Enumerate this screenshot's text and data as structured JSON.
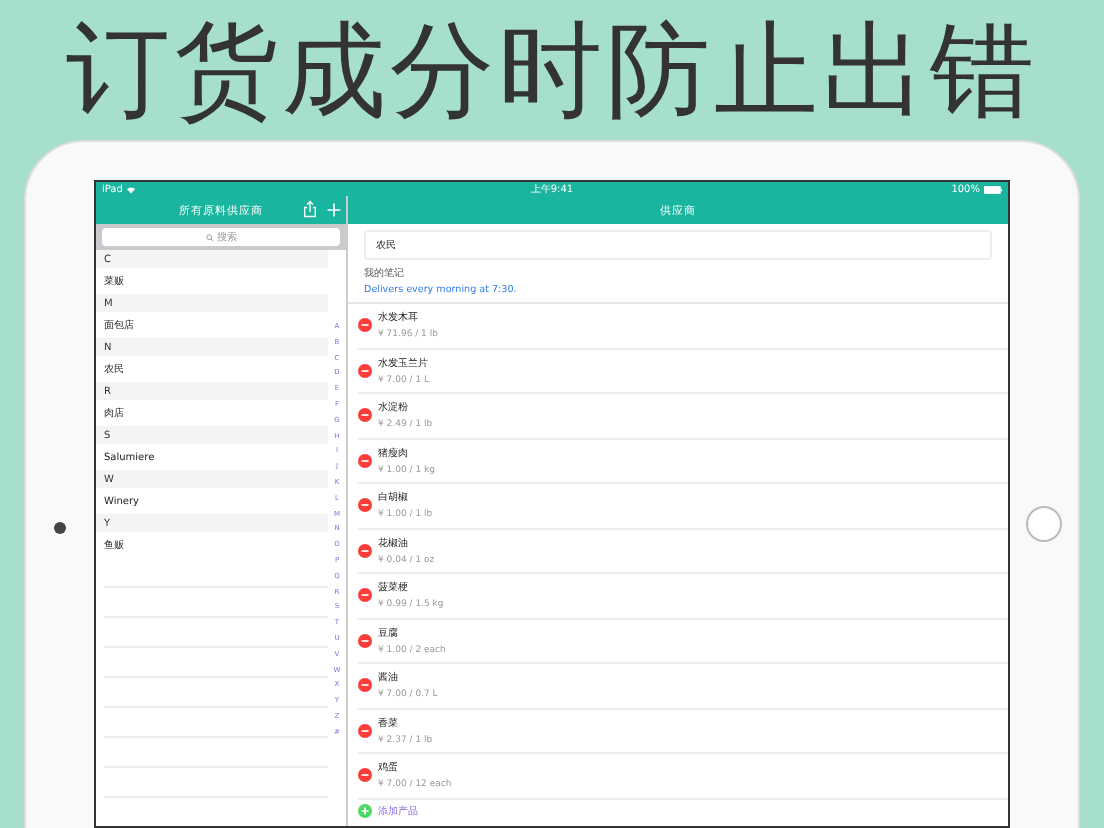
{
  "headline": "订货成分时防止出错",
  "status_bar": {
    "device": "iPad",
    "time": "上午9:41",
    "battery": "100%"
  },
  "sidebar": {
    "title": "所有原料供应商",
    "search": {
      "placeholder": "搜索"
    },
    "sections": [
      {
        "header": "C",
        "items": [
          "菜贩"
        ]
      },
      {
        "header": "M",
        "items": [
          "面包店"
        ]
      },
      {
        "header": "N",
        "items": [
          "农民"
        ]
      },
      {
        "header": "R",
        "items": [
          "肉店"
        ]
      },
      {
        "header": "S",
        "items": [
          "Salumiere"
        ]
      },
      {
        "header": "W",
        "items": [
          "Winery"
        ]
      },
      {
        "header": "Y",
        "items": [
          "鱼贩"
        ]
      }
    ],
    "index": [
      "A",
      "B",
      "C",
      "D",
      "E",
      "F",
      "G",
      "H",
      "I",
      "J",
      "K",
      "L",
      "M",
      "N",
      "O",
      "P",
      "Q",
      "R",
      "S",
      "T",
      "U",
      "V",
      "W",
      "X",
      "Y",
      "Z",
      "#"
    ]
  },
  "detail": {
    "title": "供应商",
    "name_field": {
      "value": "农民"
    },
    "notes_label": "我的笔记",
    "note": "Delivers every morning at 7:30.",
    "products": [
      {
        "name": "水发木耳",
        "price": "¥ 71.96 / 1 lb"
      },
      {
        "name": "水发玉兰片",
        "price": "¥ 7.00 / 1 L"
      },
      {
        "name": "水淀粉",
        "price": "¥ 2.49 / 1 lb"
      },
      {
        "name": "猪瘦肉",
        "price": "¥ 1.00 / 1 kg"
      },
      {
        "name": "白胡椒",
        "price": "¥ 1.00 / 1 lb"
      },
      {
        "name": "花椒油",
        "price": "¥ 0.04 / 1 oz"
      },
      {
        "name": "菠菜梗",
        "price": "¥ 0.99 / 1.5 kg"
      },
      {
        "name": "豆腐",
        "price": "¥ 1.00 / 2 each"
      },
      {
        "name": "酱油",
        "price": "¥ 7.00 / 0.7 L"
      },
      {
        "name": "香菜",
        "price": "¥ 2.37 / 1 lb"
      },
      {
        "name": "鸡蛋",
        "price": "¥ 7.00 / 12 each"
      }
    ],
    "add_button": "添加产品"
  }
}
